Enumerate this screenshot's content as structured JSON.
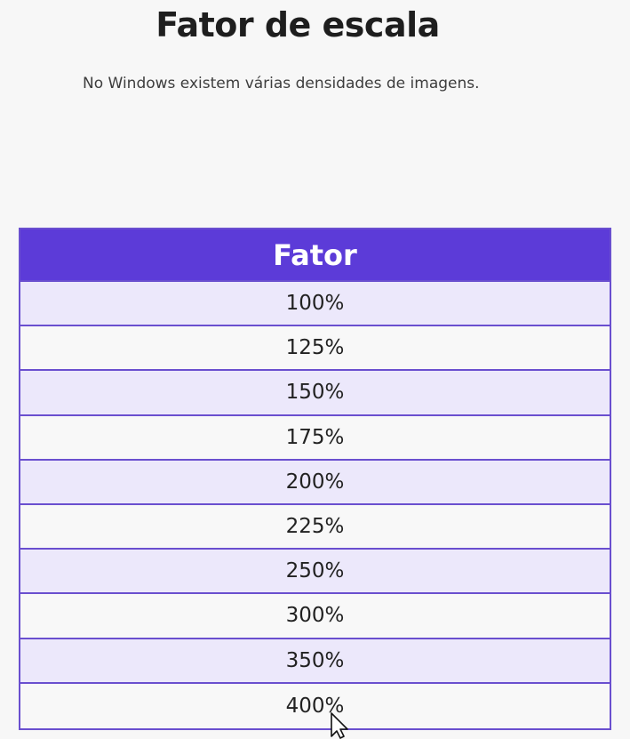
{
  "heading": {
    "title": "Fator de escala",
    "subtitle": "No Windows existem várias densidades de imagens."
  },
  "table": {
    "header": "Fator",
    "rows": [
      "100%",
      "125%",
      "150%",
      "175%",
      "200%",
      "225%",
      "250%",
      "300%",
      "350%",
      "400%"
    ]
  },
  "colors": {
    "header_background": "#5c3bd8",
    "border": "#6a4fcf",
    "row_alt": "#ece8fb"
  },
  "icons": {
    "cursor": "mouse-pointer-icon"
  }
}
